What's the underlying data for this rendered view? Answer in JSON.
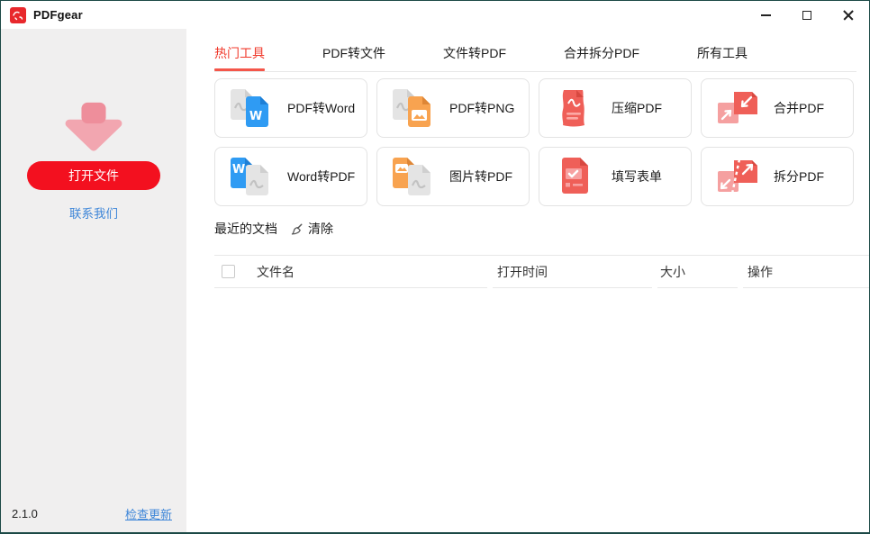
{
  "titlebar": {
    "title": "PDFgear",
    "controls": {
      "minimize": "minimize",
      "maximize": "maximize",
      "close": "close"
    }
  },
  "sidebar": {
    "open_button_label": "打开文件",
    "contact_link": "联系我们",
    "version": "2.1.0",
    "update_link": "检查更新"
  },
  "tabs": [
    {
      "label": "热门工具",
      "active": true
    },
    {
      "label": "PDF转文件",
      "active": false
    },
    {
      "label": "文件转PDF",
      "active": false
    },
    {
      "label": "合并拆分PDF",
      "active": false
    },
    {
      "label": "所有工具",
      "active": false
    }
  ],
  "tools": [
    {
      "label": "PDF转Word",
      "icon": "pdf-to-word-icon"
    },
    {
      "label": "PDF转PNG",
      "icon": "pdf-to-png-icon"
    },
    {
      "label": "压缩PDF",
      "icon": "compress-pdf-icon"
    },
    {
      "label": "合并PDF",
      "icon": "merge-pdf-icon"
    },
    {
      "label": "Word转PDF",
      "icon": "word-to-pdf-icon"
    },
    {
      "label": "图片转PDF",
      "icon": "image-to-pdf-icon"
    },
    {
      "label": "填写表单",
      "icon": "fill-form-icon"
    },
    {
      "label": "拆分PDF",
      "icon": "split-pdf-icon"
    }
  ],
  "recent": {
    "title": "最近的文档",
    "clear_label": "清除",
    "columns": [
      "文件名",
      "打开时间",
      "大小",
      "操作"
    ],
    "rows": []
  },
  "colors": {
    "accent_red": "#f3101f",
    "active_tab_red": "#f0392b",
    "tab_underline": "#f4564a",
    "link_blue": "#3e86d8",
    "icon_red": "#ef5f58",
    "icon_pink": "#f5a0a0",
    "icon_blue": "#2f9bf3",
    "icon_orange": "#f8a350",
    "doc_gray": "#e4e4e4",
    "window_border": "#1c4946",
    "sidebar_bg": "#f0efef"
  }
}
